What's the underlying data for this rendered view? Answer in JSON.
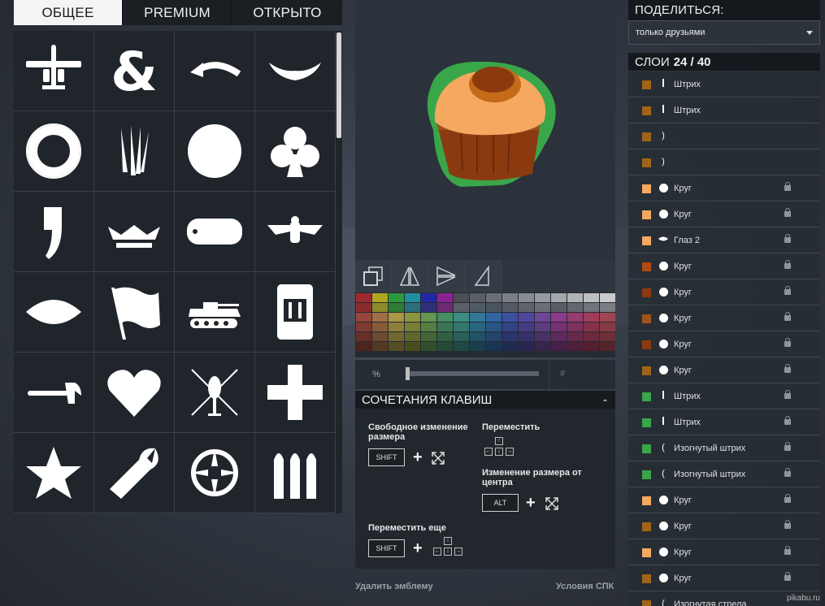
{
  "tabs": [
    {
      "label": "ОБЩЕЕ",
      "active": true
    },
    {
      "label": "PREMIUM",
      "active": false
    },
    {
      "label": "ОТКРЫТО",
      "active": false
    }
  ],
  "icon_grid": [
    "airplane-icon",
    "ampersand-icon",
    "curved-arrow-icon",
    "wings-icon",
    "lifebuoy-icon",
    "claw-marks-icon",
    "circle-icon",
    "club-icon",
    "comma-icon",
    "crown-icon",
    "dog-tag-icon",
    "eagle-icon",
    "lens-shape-icon",
    "flag-icon",
    "tank-icon",
    "cabinet-icon",
    "hammer-icon",
    "heart-icon",
    "crossed-helicopter-icon",
    "cross-icon",
    "star-icon",
    "wrench-icon",
    "crosshair-icon",
    "bullets-icon"
  ],
  "palette": {
    "row1": [
      "#9c2a2e",
      "#b0a521",
      "#2a9a3c",
      "#1f8fa0",
      "#2427a5",
      "#8a2392",
      "#4a4f57",
      "#5a5f67",
      "#6a6f77",
      "#7a7f87",
      "#888c93",
      "#969aa0",
      "#a3a6ab",
      "#b0b2b6",
      "#bcbec1",
      "#c9cacc"
    ],
    "row2": [
      "#8b2a2f",
      "#8f8a2a",
      "#2f7a36",
      "#2a6f7a",
      "#2e307a",
      "#6d2a73",
      "#5b6068",
      "#505a64",
      "#4b5560",
      "#555b64",
      "#5f646c",
      "#6a6e75",
      "#585d65",
      "#636870",
      "#6f737a",
      "#7a7e84"
    ]
  },
  "slider": {
    "label": "%",
    "value_fraction": 0.0,
    "hash": "#"
  },
  "shortcuts": {
    "title": "СОЧЕТАНИЯ КЛАВИШ",
    "collapse": "-",
    "free_resize": "Свободное изменение размера",
    "move": "Переместить",
    "resize_center": "Изменение размера от центра",
    "move_more": "Переместить еще",
    "shift": "SHIFT",
    "alt": "ALT",
    "plus": "+"
  },
  "footer": {
    "delete": "Удалить эмблему",
    "terms": "Условия СПК"
  },
  "share": {
    "title": "ПОДЕЛИТЬСЯ:",
    "value": "только друзьями"
  },
  "layers": {
    "title": "СЛОИ",
    "count": "24 / 40",
    "items": [
      {
        "color": "#a06418",
        "glyph": "bar",
        "name": "Штрих",
        "lock": false
      },
      {
        "color": "#a06418",
        "glyph": "bar",
        "name": "Штрих",
        "lock": false
      },
      {
        "color": "#a06418",
        "glyph": ")",
        "name": "",
        "lock": false
      },
      {
        "color": "#a06418",
        "glyph": ")",
        "name": "",
        "lock": false
      },
      {
        "color": "#f4a860",
        "glyph": "dot",
        "name": "Круг",
        "lock": true
      },
      {
        "color": "#f4a860",
        "glyph": "dot",
        "name": "Круг",
        "lock": true
      },
      {
        "color": "#f4a860",
        "glyph": "eye",
        "name": "Глаз 2",
        "lock": true
      },
      {
        "color": "#b04a12",
        "glyph": "dot",
        "name": "Круг",
        "lock": true
      },
      {
        "color": "#8b3a10",
        "glyph": "dot",
        "name": "Круг",
        "lock": true
      },
      {
        "color": "#a0521a",
        "glyph": "dot",
        "name": "Круг",
        "lock": true
      },
      {
        "color": "#8b3a10",
        "glyph": "dot",
        "name": "Круг",
        "lock": true
      },
      {
        "color": "#a06418",
        "glyph": "dot",
        "name": "Круг",
        "lock": true
      },
      {
        "color": "#3aa64a",
        "glyph": "bar",
        "name": "Штрих",
        "lock": true
      },
      {
        "color": "#3aa64a",
        "glyph": "bar",
        "name": "Штрих",
        "lock": true
      },
      {
        "color": "#3aa64a",
        "glyph": "(",
        "name": "Изогнутый штрих",
        "lock": true
      },
      {
        "color": "#3aa64a",
        "glyph": "(",
        "name": "Изогнутый штрих",
        "lock": true
      },
      {
        "color": "#f4a860",
        "glyph": "dot",
        "name": "Круг",
        "lock": true
      },
      {
        "color": "#a06418",
        "glyph": "dot",
        "name": "Круг",
        "lock": true
      },
      {
        "color": "#f4a860",
        "glyph": "dot",
        "name": "Круг",
        "lock": true
      },
      {
        "color": "#a06418",
        "glyph": "dot",
        "name": "Круг",
        "lock": true
      },
      {
        "color": "#a06418",
        "glyph": "(",
        "name": "Изогнутая стрела",
        "lock": false
      }
    ]
  },
  "watermark": "pikabu.ru"
}
